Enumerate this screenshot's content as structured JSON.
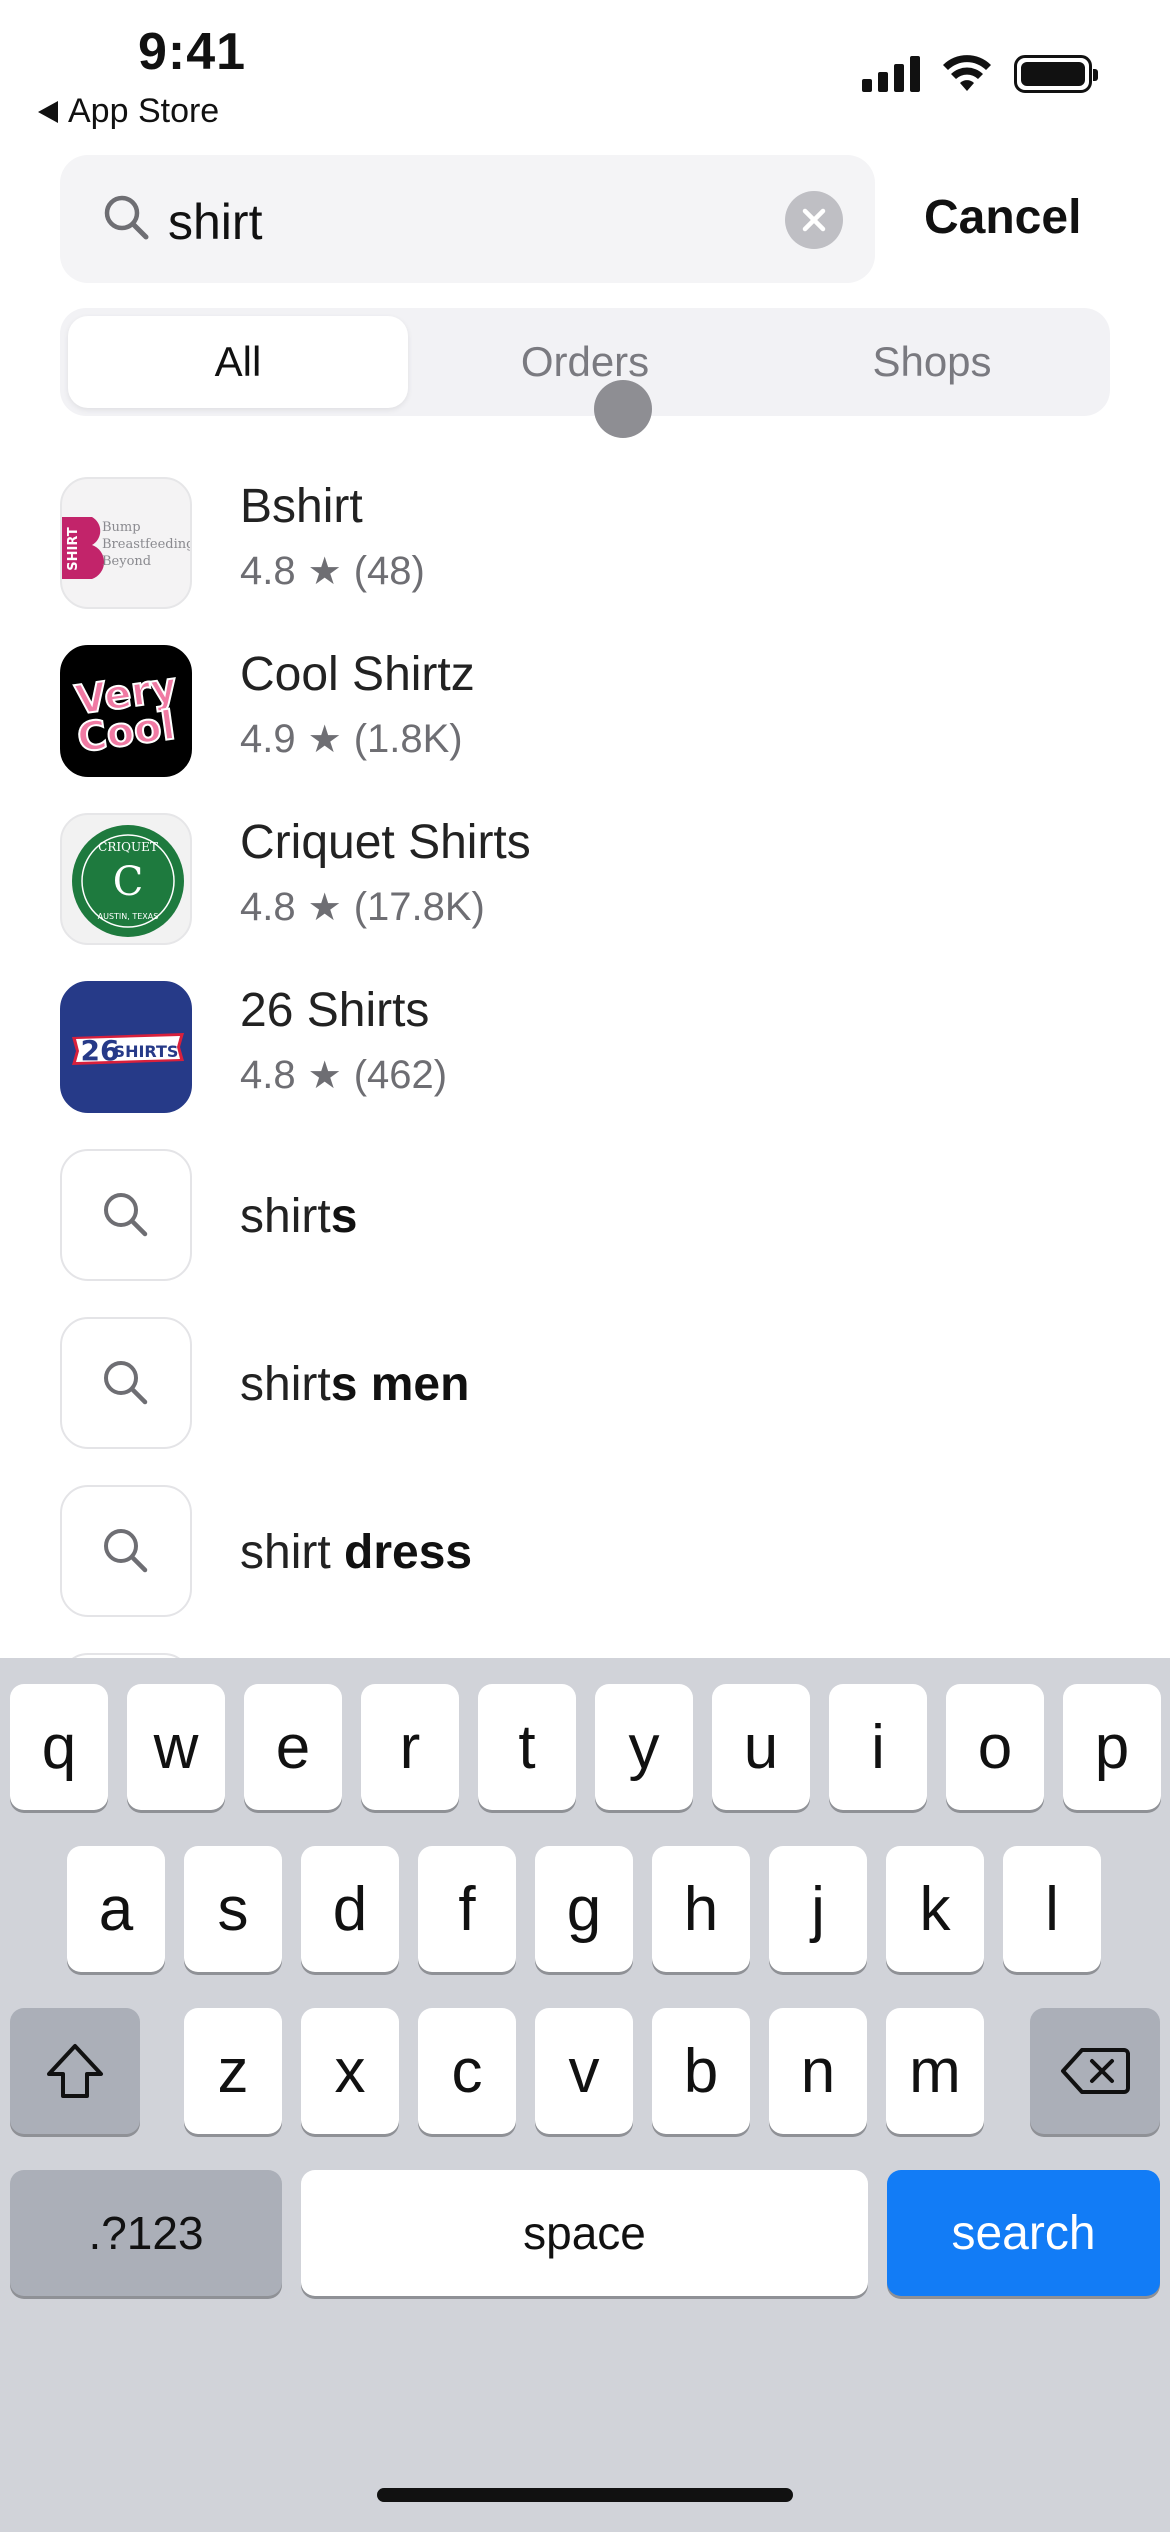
{
  "status_bar": {
    "time": "9:41",
    "back_label": "App Store"
  },
  "search": {
    "query": "shirt",
    "cancel_label": "Cancel"
  },
  "tabs": [
    {
      "label": "All",
      "active": true
    },
    {
      "label": "Orders",
      "active": false
    },
    {
      "label": "Shops",
      "active": false
    }
  ],
  "apps": [
    {
      "name": "Bshirt",
      "rating": "4.8",
      "reviews": "(48)",
      "icon": "bshirt-logo",
      "icon_text": [
        "SHIRT",
        "Bump",
        "Breastfeeding",
        "Beyond"
      ]
    },
    {
      "name": "Cool Shirtz",
      "rating": "4.9",
      "reviews": "(1.8K)",
      "icon": "very-cool-logo",
      "icon_text": [
        "Very",
        "Cool"
      ]
    },
    {
      "name": "Criquet Shirts",
      "rating": "4.8",
      "reviews": "(17.8K)",
      "icon": "criquet-logo",
      "icon_text": [
        "CRIQUET",
        "AUSTIN, TEXAS"
      ]
    },
    {
      "name": "26 Shirts",
      "rating": "4.8",
      "reviews": "(462)",
      "icon": "26-shirts-logo",
      "icon_text": [
        "26",
        "SHIRTS"
      ]
    }
  ],
  "suggestions": [
    {
      "prefix": "shirt",
      "rest": "s"
    },
    {
      "prefix": "shirt",
      "rest": "s men"
    },
    {
      "prefix": "shirt",
      "rest": " dress"
    }
  ],
  "keyboard": {
    "row1": [
      "q",
      "w",
      "e",
      "r",
      "t",
      "y",
      "u",
      "i",
      "o",
      "p"
    ],
    "row2": [
      "a",
      "s",
      "d",
      "f",
      "g",
      "h",
      "j",
      "k",
      "l"
    ],
    "row3": [
      "z",
      "x",
      "c",
      "v",
      "b",
      "n",
      "m"
    ],
    "numbers_label": ".?123",
    "space_label": "space",
    "search_label": "search"
  },
  "colors": {
    "accent": "#127cf6",
    "touch_indicator": "#8e8e93"
  }
}
